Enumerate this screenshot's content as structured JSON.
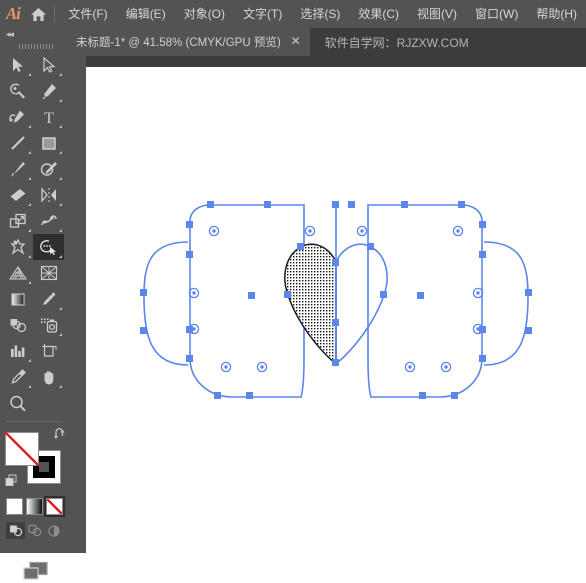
{
  "app": {
    "name": "Ai",
    "logo_color": "#e8956b"
  },
  "menubar": {
    "home_icon": "home-icon",
    "items": [
      {
        "label": "文件(F)",
        "name": "menu-file"
      },
      {
        "label": "编辑(E)",
        "name": "menu-edit"
      },
      {
        "label": "对象(O)",
        "name": "menu-object"
      },
      {
        "label": "文字(T)",
        "name": "menu-type"
      },
      {
        "label": "选择(S)",
        "name": "menu-select"
      },
      {
        "label": "效果(C)",
        "name": "menu-effect"
      },
      {
        "label": "视图(V)",
        "name": "menu-view"
      },
      {
        "label": "窗口(W)",
        "name": "menu-window"
      },
      {
        "label": "帮助(H)",
        "name": "menu-help"
      }
    ]
  },
  "tabbar": {
    "active_tab": "未标题-1* @ 41.58% (CMYK/GPU 预览)",
    "close_glyph": "✕",
    "watermark": "软件自学网：RJZXW.COM"
  },
  "toolbar": {
    "collapse_glyph": "◂◂",
    "tools": [
      {
        "name": "selection-tool",
        "icon": "arrow-solid",
        "has_flyout": true,
        "selected": false
      },
      {
        "name": "direct-selection-tool",
        "icon": "arrow-hollow",
        "has_flyout": true,
        "selected": false
      },
      {
        "name": "magic-wand-tool",
        "icon": "magic-wand",
        "has_flyout": false,
        "selected": false
      },
      {
        "name": "pen-tool",
        "icon": "pen",
        "has_flyout": true,
        "selected": false
      },
      {
        "name": "add-anchor-point-tool",
        "icon": "pen-add-anchor",
        "has_flyout": true,
        "selected": false
      },
      {
        "name": "type-tool",
        "icon": "type-T",
        "has_flyout": true,
        "selected": false
      },
      {
        "name": "line-segment-tool",
        "icon": "line-segment",
        "has_flyout": true,
        "selected": false
      },
      {
        "name": "rectangle-tool",
        "icon": "rectangle",
        "has_flyout": true,
        "selected": false
      },
      {
        "name": "paintbrush-tool",
        "icon": "paintbrush",
        "has_flyout": true,
        "selected": false
      },
      {
        "name": "shaper-tool",
        "icon": "shaper-pencil",
        "has_flyout": true,
        "selected": false
      },
      {
        "name": "eraser-tool",
        "icon": "eraser",
        "has_flyout": true,
        "selected": false
      },
      {
        "name": "reflect-tool",
        "icon": "rotate-reflect",
        "has_flyout": true,
        "selected": false
      },
      {
        "name": "scale-tool",
        "icon": "scale",
        "has_flyout": true,
        "selected": false
      },
      {
        "name": "width-tool",
        "icon": "warp-width",
        "has_flyout": true,
        "selected": false
      },
      {
        "name": "free-transform-tool",
        "icon": "puppet-pin",
        "has_flyout": true,
        "selected": false
      },
      {
        "name": "shape-builder-tool",
        "icon": "shape-builder",
        "has_flyout": true,
        "selected": true
      },
      {
        "name": "perspective-grid-tool",
        "icon": "perspective-grid",
        "has_flyout": true,
        "selected": false
      },
      {
        "name": "mesh-tool",
        "icon": "mesh",
        "has_flyout": false,
        "selected": false
      },
      {
        "name": "gradient-tool",
        "icon": "gradient",
        "has_flyout": false,
        "selected": false
      },
      {
        "name": "eyedropper-tool",
        "icon": "eyedropper",
        "has_flyout": true,
        "selected": false
      },
      {
        "name": "blend-tool",
        "icon": "blend",
        "has_flyout": false,
        "selected": false
      },
      {
        "name": "symbol-sprayer-tool",
        "icon": "symbol-sprayer",
        "has_flyout": true,
        "selected": false
      },
      {
        "name": "column-graph-tool",
        "icon": "column-graph",
        "has_flyout": true,
        "selected": false
      },
      {
        "name": "artboard-tool",
        "icon": "artboard",
        "has_flyout": false,
        "selected": false
      },
      {
        "name": "slice-tool",
        "icon": "slice-knife",
        "has_flyout": true,
        "selected": false
      },
      {
        "name": "hand-tool",
        "icon": "hand",
        "has_flyout": true,
        "selected": false
      },
      {
        "name": "zoom-tool",
        "icon": "magnifier",
        "has_flyout": false,
        "selected": false
      }
    ],
    "fill": {
      "name": "fill-swatch",
      "value": "none",
      "color": "#ffffff",
      "none_slash_color": "#e02020"
    },
    "stroke": {
      "name": "stroke-swatch",
      "value": "black",
      "color": "#000000"
    },
    "swap_icon": "swap-fill-stroke-icon",
    "default_icon": "default-fill-stroke-icon",
    "paint_modes": [
      {
        "name": "color-mode-button",
        "icon": "solid-color",
        "active": false
      },
      {
        "name": "gradient-mode-button",
        "icon": "gradient-swatch",
        "active": false
      },
      {
        "name": "none-mode-button",
        "icon": "none-swatch",
        "active": true
      }
    ],
    "draw_modes": [
      {
        "name": "draw-normal-button",
        "icon": "draw-normal",
        "active": true
      },
      {
        "name": "draw-behind-button",
        "icon": "draw-behind",
        "active": false
      },
      {
        "name": "draw-inside-button",
        "icon": "draw-inside",
        "active": false
      }
    ],
    "screen_mode": {
      "name": "change-screen-mode-button",
      "icon": "screen-mode"
    }
  },
  "canvas": {
    "name": "artboard-canvas",
    "background": "#ffffff",
    "selection_color": "#4a7de8",
    "anchor_fill": "#5b86ea",
    "path_stroke_color": "#5b86ea",
    "highlight_pattern": "dotted-shape-builder-highlight",
    "highlight_dot_color": "#111111",
    "description": "Two mug outlines with handles, overlapping to form a heart shape in the center; the heart region is highlighted with the Shape Builder dotted pattern",
    "shapes": [
      {
        "name": "left-mug-body",
        "type": "rounded-rectangle"
      },
      {
        "name": "left-mug-handle",
        "type": "handle-arc"
      },
      {
        "name": "right-mug-body",
        "type": "rounded-rectangle"
      },
      {
        "name": "right-mug-handle",
        "type": "handle-arc"
      },
      {
        "name": "heart-highlight-region",
        "type": "shape-builder-region"
      }
    ]
  }
}
